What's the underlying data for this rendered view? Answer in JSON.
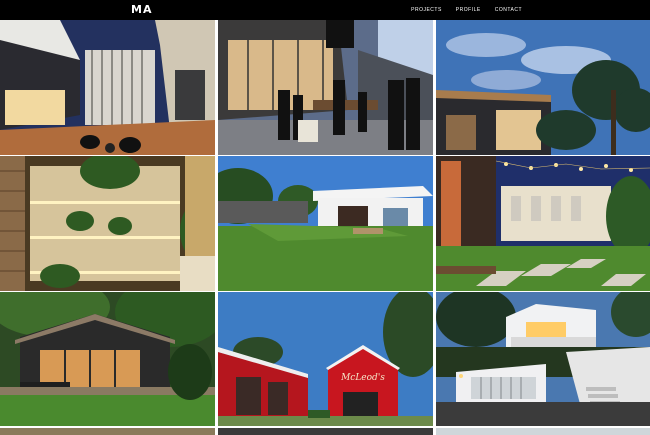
{
  "header": {
    "logo": "MA",
    "nav": [
      "PROJECTS",
      "PROFILE",
      "CONTACT"
    ]
  },
  "tiles": [
    {
      "name": "project-modern-house-deck"
    },
    {
      "name": "project-bar-evening-crowd"
    },
    {
      "name": "project-house-palm-trees"
    },
    {
      "name": "project-bar-shelves-plants"
    },
    {
      "name": "project-white-house-lawn"
    },
    {
      "name": "project-courtyard-string-lights"
    },
    {
      "name": "project-house-outdoor-dining"
    },
    {
      "name": "project-red-barn"
    },
    {
      "name": "project-white-villa-night"
    }
  ],
  "signage": {
    "red_barn_text": "McLeod's"
  },
  "colors": {
    "topbar": "#000000",
    "nav_text": "#ffffff"
  }
}
